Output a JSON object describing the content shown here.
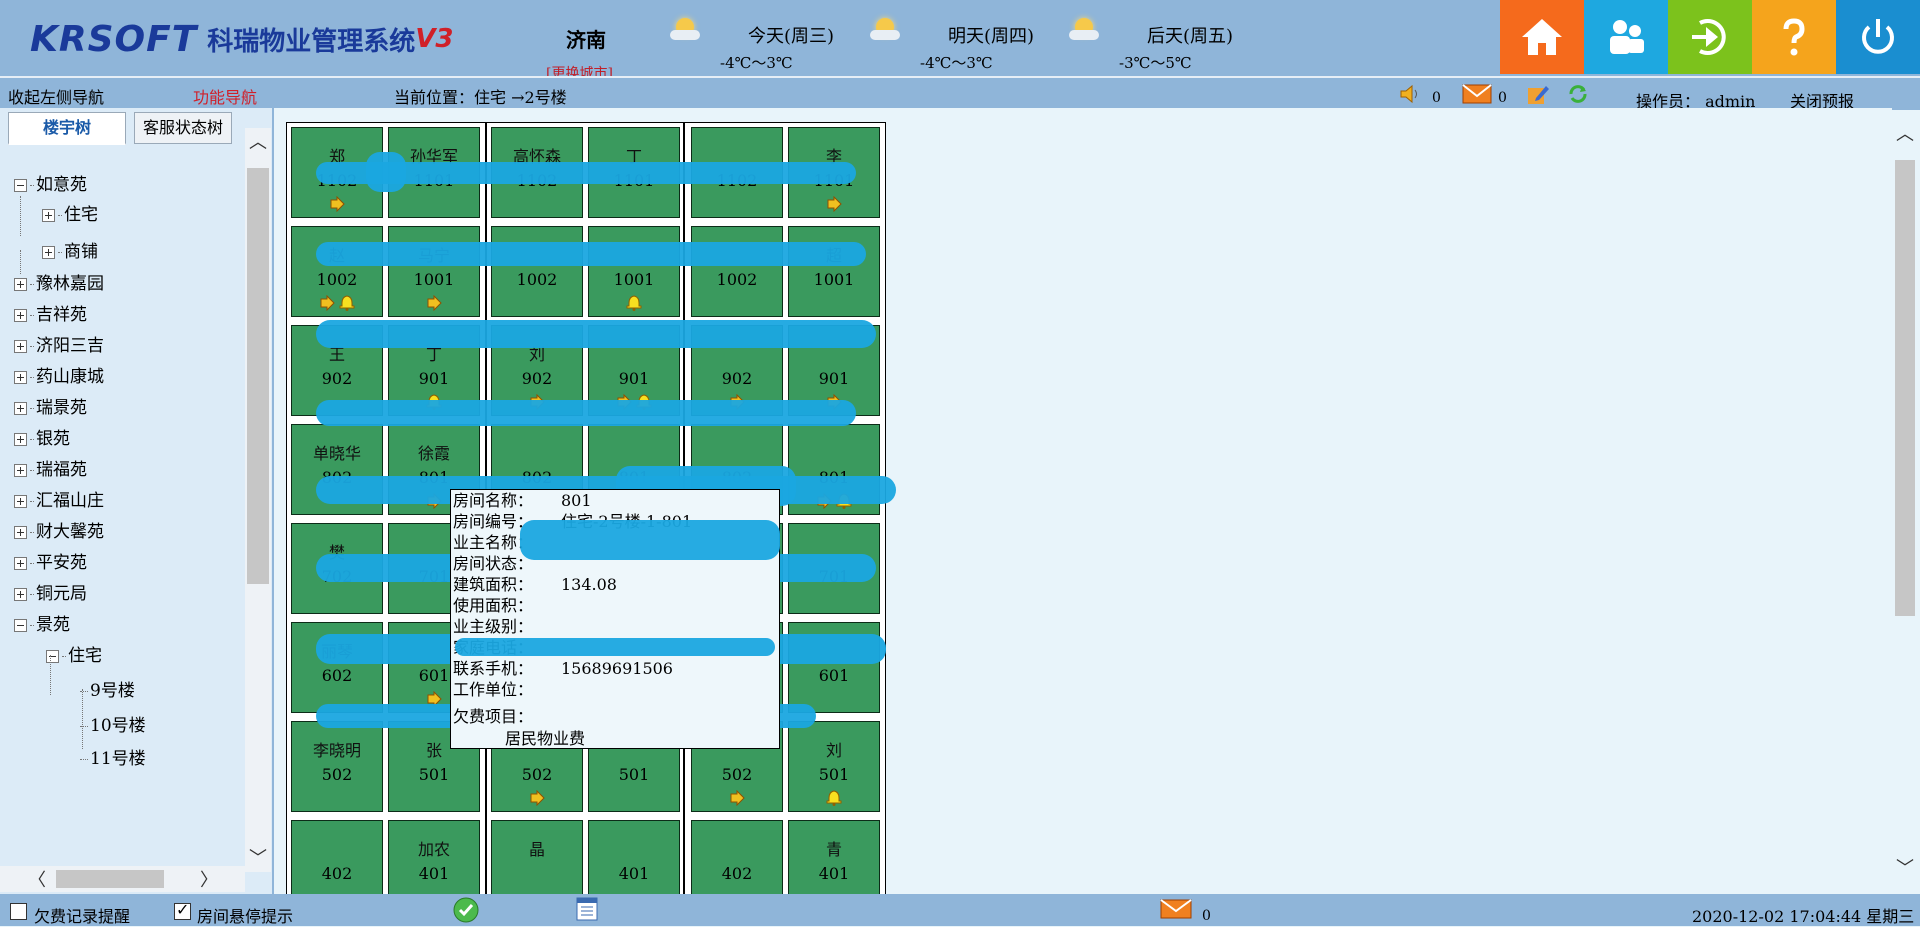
{
  "header": {
    "brand": "KRSOFT",
    "system_name": "科瑞物业管理系统",
    "version": "V3",
    "city": "济南",
    "switch_city": "[更换城市]",
    "weather": [
      {
        "day": "今天(周三)",
        "temp": "-4℃～3℃",
        "icon": "partly-cloudy-icon"
      },
      {
        "day": "明天(周四)",
        "temp": "-4℃～3℃",
        "icon": "partly-cloudy-icon"
      },
      {
        "day": "后天(周五)",
        "temp": "-3℃～5℃",
        "icon": "partly-cloudy-icon"
      }
    ],
    "tiles": [
      {
        "name": "home-icon",
        "color": "#f56a1c"
      },
      {
        "name": "users-icon",
        "color": "#1ea8e0"
      },
      {
        "name": "login-icon",
        "color": "#7cc21c"
      },
      {
        "name": "help-icon",
        "color": "#f5a41c"
      },
      {
        "name": "power-icon",
        "color": "#1a8ed0"
      }
    ]
  },
  "subbar": {
    "collapse_nav": "收起左侧导航",
    "func_nav": "功能导航",
    "location": "当前位置：住宅 →2号楼",
    "sound_count": "0",
    "mail_count": "0",
    "operator": "操作员：  admin",
    "close_forecast": "关闭预报"
  },
  "left_panel": {
    "tabs": [
      "楼宇树",
      "客服状态树"
    ],
    "tree": [
      {
        "label": "如意苑",
        "level": 0,
        "state": "expanded"
      },
      {
        "label": "住宅",
        "level": 1,
        "state": "collapsed"
      },
      {
        "label": "商铺",
        "level": 1,
        "state": "collapsed"
      },
      {
        "label": "豫林嘉园",
        "level": 0,
        "state": "collapsed"
      },
      {
        "label": "吉祥苑",
        "level": 0,
        "state": "collapsed"
      },
      {
        "label": "济阳三吉",
        "level": 0,
        "state": "collapsed"
      },
      {
        "label": "药山康城",
        "level": 0,
        "state": "collapsed"
      },
      {
        "label": "瑞景苑",
        "level": 0,
        "state": "collapsed"
      },
      {
        "label": "银苑",
        "level": 0,
        "state": "collapsed"
      },
      {
        "label": "瑞福苑",
        "level": 0,
        "state": "collapsed"
      },
      {
        "label": "汇福山庄",
        "level": 0,
        "state": "collapsed"
      },
      {
        "label": "财大馨苑",
        "level": 0,
        "state": "collapsed"
      },
      {
        "label": "平安苑",
        "level": 0,
        "state": "collapsed"
      },
      {
        "label": "铜元局",
        "level": 0,
        "state": "collapsed"
      },
      {
        "label": "景苑",
        "level": 0,
        "state": "expanded"
      },
      {
        "label": "住宅",
        "level": 1,
        "state": "expanded"
      },
      {
        "label": "9号楼",
        "level": 2,
        "state": "leaf"
      },
      {
        "label": "10号楼",
        "level": 2,
        "state": "leaf"
      },
      {
        "label": "11号楼",
        "level": 2,
        "state": "leaf"
      }
    ]
  },
  "rooms": [
    [
      {
        "n": "郑",
        "no": "1102",
        "a": 1,
        "b": 0
      },
      {
        "n": "孙华军",
        "no": "1101",
        "a": 0,
        "b": 0
      },
      {
        "n": "高怀森",
        "no": "1102",
        "a": 0,
        "b": 0
      },
      {
        "n": "丁",
        "no": "1101",
        "a": 0,
        "b": 0
      },
      {
        "n": "",
        "no": "1102",
        "a": 0,
        "b": 0
      },
      {
        "n": "李",
        "no": "1101",
        "a": 1,
        "b": 0
      }
    ],
    [
      {
        "n": "赵",
        "no": "1002",
        "a": 1,
        "b": 1
      },
      {
        "n": "马宁",
        "no": "1001",
        "a": 1,
        "b": 0
      },
      {
        "n": "",
        "no": "1002",
        "a": 0,
        "b": 0
      },
      {
        "n": "",
        "no": "1001",
        "a": 0,
        "b": 1
      },
      {
        "n": "",
        "no": "1002",
        "a": 0,
        "b": 0
      },
      {
        "n": "超",
        "no": "1001",
        "a": 0,
        "b": 0
      }
    ],
    [
      {
        "n": "王",
        "no": "902",
        "a": 0,
        "b": 0
      },
      {
        "n": "丁",
        "no": "901",
        "a": 0,
        "b": 1
      },
      {
        "n": "刘",
        "no": "902",
        "a": 1,
        "b": 0
      },
      {
        "n": "",
        "no": "901",
        "a": 1,
        "b": 1
      },
      {
        "n": "",
        "no": "902",
        "a": 1,
        "b": 0
      },
      {
        "n": "",
        "no": "901",
        "a": 1,
        "b": 0
      }
    ],
    [
      {
        "n": "单晓华",
        "no": "802",
        "a": 0,
        "b": 0
      },
      {
        "n": "徐霞",
        "no": "801",
        "a": 1,
        "b": 0
      },
      {
        "n": "",
        "no": "802",
        "a": 0,
        "b": 0
      },
      {
        "n": "",
        "no": "801",
        "a": 0,
        "b": 0
      },
      {
        "n": "",
        "no": "802",
        "a": 0,
        "b": 0
      },
      {
        "n": "",
        "no": "801",
        "a": 1,
        "b": 1
      }
    ],
    [
      {
        "n": "樊",
        "no": "702",
        "a": 0,
        "b": 0
      },
      {
        "n": "",
        "no": "701",
        "a": 0,
        "b": 0
      },
      {
        "n": "",
        "no": "",
        "a": 0,
        "b": 0
      },
      {
        "n": "",
        "no": "",
        "a": 0,
        "b": 0
      },
      {
        "n": "",
        "no": "",
        "a": 0,
        "b": 0
      },
      {
        "n": "",
        "no": "701",
        "a": 0,
        "b": 0
      }
    ],
    [
      {
        "n": "丽琴",
        "no": "602",
        "a": 0,
        "b": 0
      },
      {
        "n": "",
        "no": "601",
        "a": 1,
        "b": 0
      },
      {
        "n": "",
        "no": "",
        "a": 0,
        "b": 0
      },
      {
        "n": "",
        "no": "",
        "a": 0,
        "b": 0
      },
      {
        "n": "",
        "no": "",
        "a": 0,
        "b": 0
      },
      {
        "n": "",
        "no": "601",
        "a": 0,
        "b": 0
      }
    ],
    [
      {
        "n": "李晓明",
        "no": "502",
        "a": 0,
        "b": 0
      },
      {
        "n": "张",
        "no": "501",
        "a": 0,
        "b": 0
      },
      {
        "n": "",
        "no": "502",
        "a": 1,
        "b": 0
      },
      {
        "n": "",
        "no": "501",
        "a": 0,
        "b": 0
      },
      {
        "n": "",
        "no": "502",
        "a": 1,
        "b": 0
      },
      {
        "n": "刘",
        "no": "501",
        "a": 0,
        "b": 1
      }
    ],
    [
      {
        "n": "",
        "no": "402",
        "a": 0,
        "b": 0
      },
      {
        "n": "加农",
        "no": "401",
        "a": 0,
        "b": 0
      },
      {
        "n": "晶",
        "no": "",
        "a": 0,
        "b": 0
      },
      {
        "n": "",
        "no": "401",
        "a": 0,
        "b": 0
      },
      {
        "n": "",
        "no": "402",
        "a": 0,
        "b": 0
      },
      {
        "n": "青",
        "no": "401",
        "a": 0,
        "b": 0
      }
    ]
  ],
  "tooltip": {
    "rows": [
      {
        "label": "房间名称：",
        "value": "801"
      },
      {
        "label": "房间编号：",
        "value": "住宅-2号楼-1-801"
      },
      {
        "label": "业主名称：",
        "value": ""
      },
      {
        "label": "房间状态：",
        "value": ""
      },
      {
        "label": "建筑面积：",
        "value": "134.08"
      },
      {
        "label": "使用面积：",
        "value": ""
      },
      {
        "label": "业主级别：",
        "value": ""
      },
      {
        "label": "家庭电话：",
        "value": ""
      },
      {
        "label": "联系手机：",
        "value": "15689691506"
      },
      {
        "label": "工作单位：",
        "value": ""
      }
    ],
    "arrears_label": "欠费项目：",
    "arrears_item": "居民物业费"
  },
  "footer": {
    "arrears_reminder": "欠费记录提醒",
    "room_hover_tip": "房间悬停提示",
    "mail_count": "0",
    "datetime": "2020-12-02 17:04:44 星期三"
  }
}
